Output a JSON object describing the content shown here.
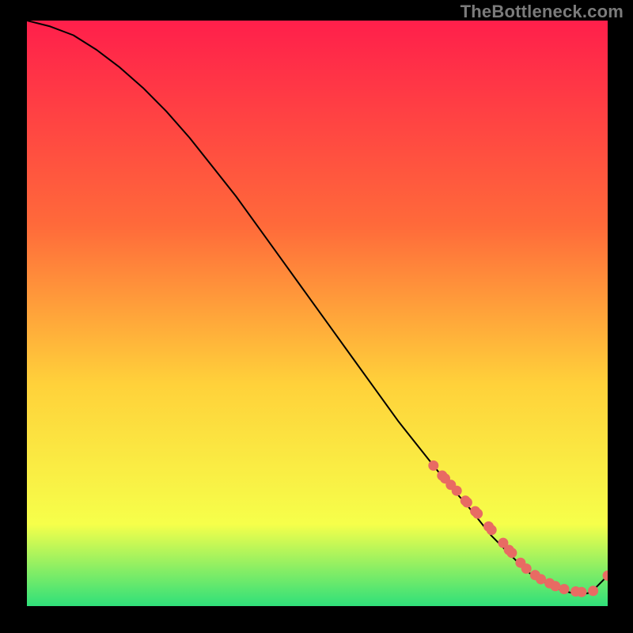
{
  "watermark": "TheBottleneck.com",
  "colors": {
    "gradient_top": "#ff1f4b",
    "gradient_mid1": "#ff6a3a",
    "gradient_mid2": "#ffd13a",
    "gradient_mid3": "#f6ff4a",
    "gradient_bottom": "#2fe07a",
    "curve": "#000000",
    "marker_fill": "#e86b63",
    "marker_stroke": "#b84f48",
    "bg_black": "#000000"
  },
  "chart_data": {
    "type": "line",
    "title": "",
    "xlabel": "",
    "ylabel": "",
    "xlim": [
      0,
      100
    ],
    "ylim": [
      0,
      100
    ],
    "curve": {
      "x": [
        0,
        4,
        8,
        12,
        16,
        20,
        24,
        28,
        32,
        36,
        40,
        44,
        48,
        52,
        56,
        60,
        64,
        68,
        72,
        76,
        80,
        82,
        83,
        84,
        86,
        88,
        90,
        92,
        94,
        96,
        97,
        98,
        100
      ],
      "y": [
        100,
        99,
        97.5,
        95,
        92,
        88.5,
        84.5,
        80,
        75,
        70,
        64.5,
        59,
        53.5,
        48,
        42.5,
        37,
        31.5,
        26.5,
        21.5,
        17,
        12,
        10,
        9,
        8,
        6,
        4.7,
        3.6,
        2.7,
        2.2,
        2.1,
        2.3,
        3.2,
        5.2
      ]
    },
    "series": [
      {
        "name": "markers",
        "type": "scatter",
        "x": [
          70,
          71.5,
          72,
          73,
          74,
          75.5,
          75.8,
          77.2,
          77.6,
          79.5,
          80.0,
          82.0,
          83.0,
          83.5,
          85.0,
          86.0,
          87.5,
          88.5,
          90.0,
          91.0,
          92.5,
          94.5,
          95.5,
          97.5,
          100.0
        ],
        "y": [
          24.0,
          22.3,
          21.8,
          20.7,
          19.7,
          18.0,
          17.7,
          16.2,
          15.8,
          13.6,
          13.0,
          10.8,
          9.6,
          9.1,
          7.4,
          6.4,
          5.3,
          4.6,
          3.9,
          3.4,
          2.9,
          2.5,
          2.4,
          2.6,
          5.2
        ]
      }
    ],
    "gradient_stops": [
      {
        "offset": 0.0,
        "key": "gradient_top"
      },
      {
        "offset": 0.35,
        "key": "gradient_mid1"
      },
      {
        "offset": 0.62,
        "key": "gradient_mid2"
      },
      {
        "offset": 0.86,
        "key": "gradient_mid3"
      },
      {
        "offset": 1.0,
        "key": "gradient_bottom"
      }
    ]
  }
}
